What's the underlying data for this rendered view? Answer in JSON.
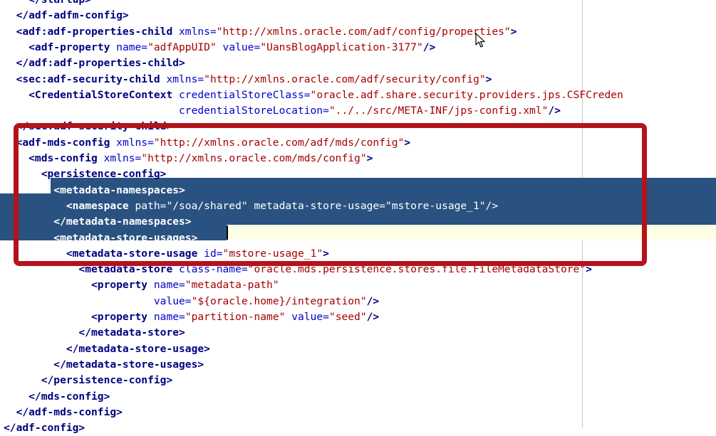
{
  "colors": {
    "tag": "#000080",
    "attribute": "#0000cc",
    "value": "#a60000",
    "selection": "#2a5280",
    "highlight_box": "#b3131b",
    "current_line": "#fefee6"
  },
  "icons": {
    "mouse_cursor": "arrow-cursor-icon"
  },
  "lines": [
    [
      {
        "t": "tag",
        "v": "    </startup>"
      }
    ],
    [
      {
        "t": "tag",
        "v": "  </adf-adfm-config>"
      }
    ],
    [
      {
        "t": "tag",
        "v": "  <adf:adf-properties-child "
      },
      {
        "t": "attr",
        "v": "xmlns="
      },
      {
        "t": "val",
        "v": "\"http://xmlns.oracle.com/adf/config/properties\""
      },
      {
        "t": "tag",
        "v": ">"
      }
    ],
    [
      {
        "t": "tag",
        "v": "    <adf-property "
      },
      {
        "t": "attr",
        "v": "name="
      },
      {
        "t": "val",
        "v": "\"adfAppUID\" "
      },
      {
        "t": "attr",
        "v": "value="
      },
      {
        "t": "val",
        "v": "\"UansBlogApplication-3177\""
      },
      {
        "t": "tag",
        "v": "/>"
      }
    ],
    [
      {
        "t": "tag",
        "v": "  </adf:adf-properties-child>"
      }
    ],
    [
      {
        "t": "tag",
        "v": "  <sec:adf-security-child "
      },
      {
        "t": "attr",
        "v": "xmlns="
      },
      {
        "t": "val",
        "v": "\"http://xmlns.oracle.com/adf/security/config\""
      },
      {
        "t": "tag",
        "v": ">"
      }
    ],
    [
      {
        "t": "tag",
        "v": "    <CredentialStoreContext "
      },
      {
        "t": "attr",
        "v": "credentialStoreClass="
      },
      {
        "t": "val",
        "v": "\"oracle.adf.share.security.providers.jps.CSFCreden"
      }
    ],
    [
      {
        "t": "txt",
        "v": "                            "
      },
      {
        "t": "attr",
        "v": "credentialStoreLocation="
      },
      {
        "t": "val",
        "v": "\"../../src/META-INF/jps-config.xml\""
      },
      {
        "t": "tag",
        "v": "/>"
      }
    ],
    [
      {
        "t": "tag",
        "v": "  </sec:adf-security-child>"
      }
    ],
    [
      {
        "t": "tag",
        "v": "  <adf-mds-config "
      },
      {
        "t": "attr",
        "v": "xmlns="
      },
      {
        "t": "val",
        "v": "\"http://xmlns.oracle.com/adf/mds/config\""
      },
      {
        "t": "tag",
        "v": ">"
      }
    ],
    [
      {
        "t": "tag",
        "v": "    <mds-config "
      },
      {
        "t": "attr",
        "v": "xmlns="
      },
      {
        "t": "val",
        "v": "\"http://xmlns.oracle.com/mds/config\""
      },
      {
        "t": "tag",
        "v": ">"
      }
    ],
    [
      {
        "t": "tag",
        "v": "      <persistence-config>"
      }
    ],
    [
      {
        "t": "tag",
        "v": "        <metadata-namespaces>"
      }
    ],
    [
      {
        "t": "tag",
        "v": "          <namespace "
      },
      {
        "t": "txt",
        "v": "path=\"/soa/shared\" metadata-store-usage=\"mstore-usage_1\"/>"
      }
    ],
    [
      {
        "t": "tag",
        "v": "        </metadata-namespaces>"
      }
    ],
    [
      {
        "t": "tag",
        "v": "        <metadata-store-usages>"
      }
    ],
    [
      {
        "t": "tag",
        "v": "          <metadata-store-usage "
      },
      {
        "t": "attr",
        "v": "id="
      },
      {
        "t": "val",
        "v": "\"mstore-usage_1\""
      },
      {
        "t": "tag",
        "v": ">"
      }
    ],
    [
      {
        "t": "tag",
        "v": "            <metadata-store "
      },
      {
        "t": "attr",
        "v": "class-name="
      },
      {
        "t": "val",
        "v": "\"oracle.mds.persistence.stores.file.FileMetadataStore\""
      },
      {
        "t": "tag",
        "v": ">"
      }
    ],
    [
      {
        "t": "tag",
        "v": "              <property "
      },
      {
        "t": "attr",
        "v": "name="
      },
      {
        "t": "val",
        "v": "\"metadata-path\""
      }
    ],
    [
      {
        "t": "txt",
        "v": "                        "
      },
      {
        "t": "attr",
        "v": "value="
      },
      {
        "t": "val",
        "v": "\"${oracle.home}/integration\""
      },
      {
        "t": "tag",
        "v": "/>"
      }
    ],
    [
      {
        "t": "tag",
        "v": "              <property "
      },
      {
        "t": "attr",
        "v": "name="
      },
      {
        "t": "val",
        "v": "\"partition-name\" "
      },
      {
        "t": "attr",
        "v": "value="
      },
      {
        "t": "val",
        "v": "\"seed\""
      },
      {
        "t": "tag",
        "v": "/>"
      }
    ],
    [
      {
        "t": "tag",
        "v": "            </metadata-store>"
      }
    ],
    [
      {
        "t": "tag",
        "v": "          </metadata-store-usage>"
      }
    ],
    [
      {
        "t": "tag",
        "v": "        </metadata-store-usages>"
      }
    ],
    [
      {
        "t": "tag",
        "v": "      </persistence-config>"
      }
    ],
    [
      {
        "t": "tag",
        "v": "    </mds-config>"
      }
    ],
    [
      {
        "t": "tag",
        "v": "  </adf-mds-config>"
      }
    ],
    [
      {
        "t": "tag",
        "v": "</adf-config>"
      }
    ]
  ]
}
